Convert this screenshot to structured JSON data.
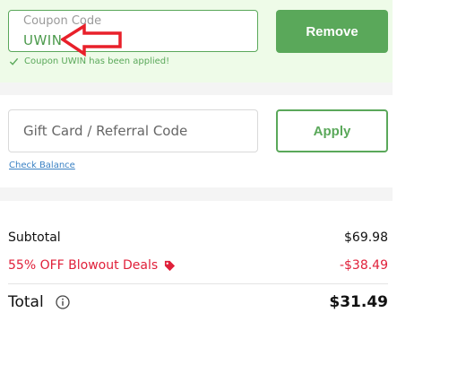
{
  "coupon": {
    "label": "Coupon Code",
    "value": "UWIN",
    "remove_label": "Remove",
    "applied_message": "Coupon UWIN has been applied!"
  },
  "gift": {
    "placeholder": "Gift Card / Referral Code",
    "apply_label": "Apply",
    "check_balance": "Check Balance"
  },
  "summary": {
    "subtotal_label": "Subtotal",
    "subtotal_amount": "$69.98",
    "discount_label": "55% OFF Blowout Deals",
    "discount_amount": "-$38.49",
    "total_label": "Total",
    "total_amount": "$31.49"
  },
  "colors": {
    "accent_green": "#5aa85a",
    "discount_red": "#e0203a",
    "panel_green": "#eefbe8",
    "annotation_red": "#e8202a"
  },
  "icons": {
    "annotation": "red-arrow-icon",
    "applied": "check-icon",
    "discount": "tag-icon",
    "total": "info-icon"
  }
}
